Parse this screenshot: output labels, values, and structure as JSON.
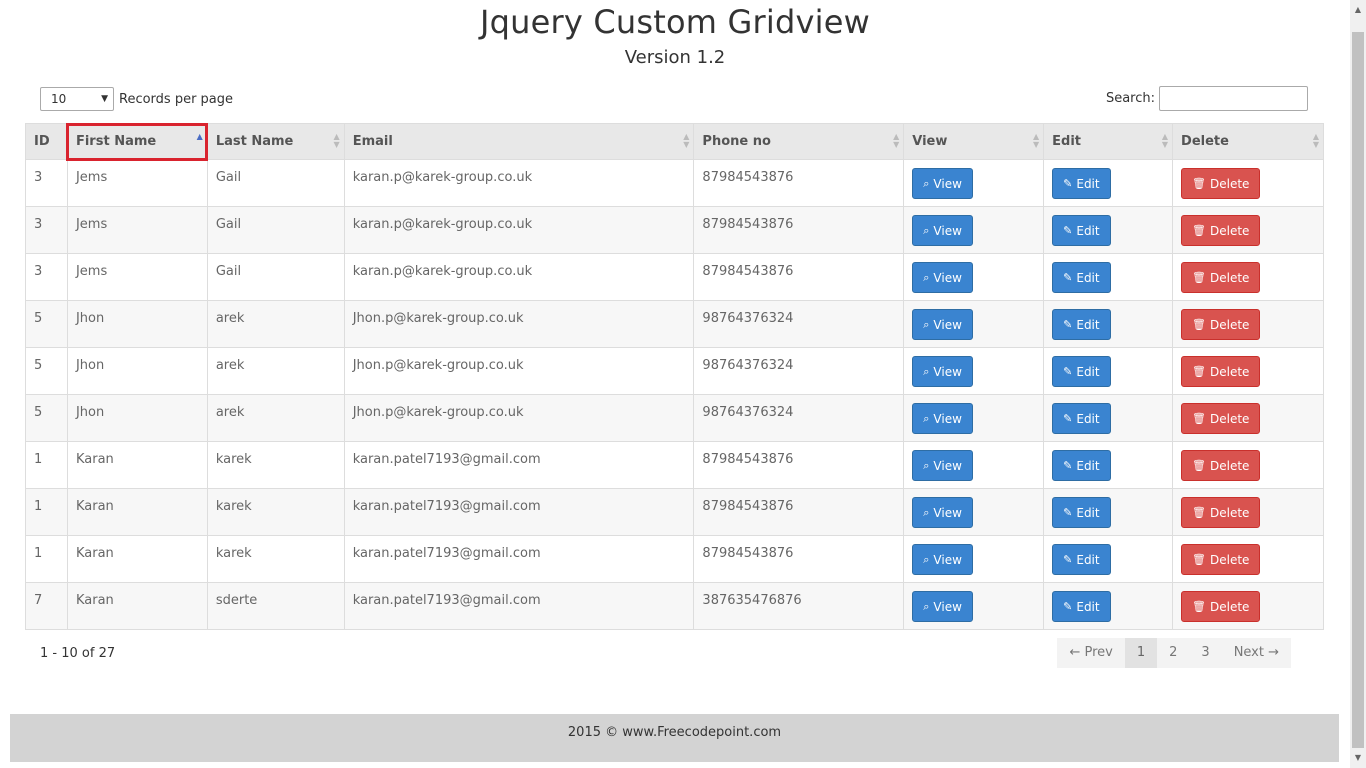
{
  "header": {
    "title": "Jquery Custom Gridview",
    "version": "Version 1.2"
  },
  "length_control": {
    "selected": "10",
    "label": "Records per page"
  },
  "search": {
    "label": "Search:",
    "value": "",
    "placeholder": ""
  },
  "columns": [
    "ID",
    "First Name",
    "Last Name",
    "Email",
    "Phone no",
    "View",
    "Edit",
    "Delete"
  ],
  "sorted_column": "First Name",
  "buttons": {
    "view": "View",
    "edit": "Edit",
    "delete": "Delete"
  },
  "rows": [
    [
      "3",
      "Jems",
      "Gail",
      "karan.p@karek-group.co.uk",
      "87984543876"
    ],
    [
      "3",
      "Jems",
      "Gail",
      "karan.p@karek-group.co.uk",
      "87984543876"
    ],
    [
      "3",
      "Jems",
      "Gail",
      "karan.p@karek-group.co.uk",
      "87984543876"
    ],
    [
      "5",
      "Jhon",
      "arek",
      "Jhon.p@karek-group.co.uk",
      "98764376324"
    ],
    [
      "5",
      "Jhon",
      "arek",
      "Jhon.p@karek-group.co.uk",
      "98764376324"
    ],
    [
      "5",
      "Jhon",
      "arek",
      "Jhon.p@karek-group.co.uk",
      "98764376324"
    ],
    [
      "1",
      "Karan",
      "karek",
      "karan.patel7193@gmail.com",
      "87984543876"
    ],
    [
      "1",
      "Karan",
      "karek",
      "karan.patel7193@gmail.com",
      "87984543876"
    ],
    [
      "1",
      "Karan",
      "karek",
      "karan.patel7193@gmail.com",
      "87984543876"
    ],
    [
      "7",
      "Karan",
      "sderte",
      "karan.patel7193@gmail.com",
      "387635476876"
    ]
  ],
  "info": "1 - 10 of 27",
  "pagination": {
    "prev": "← Prev",
    "pages": [
      "1",
      "2",
      "3"
    ],
    "active": "1",
    "next": "Next →"
  },
  "footer": "2015 © www.Freecodepoint.com",
  "colors": {
    "primary": "#3a84d0",
    "danger": "#d9534f",
    "highlight": "#d9232e"
  }
}
